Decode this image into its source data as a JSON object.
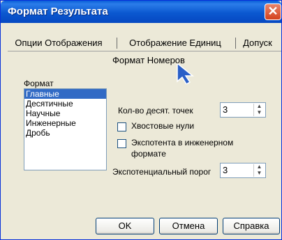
{
  "window": {
    "title": "Формат Результата",
    "close_glyph": "✕"
  },
  "tabs": [
    "Опции Отображения",
    "Отображение Единиц",
    "Допуск"
  ],
  "group_title": "Формат Номеров",
  "format": {
    "label": "Формат",
    "items": [
      "Главные",
      "Десятичные",
      "Научные",
      "Инженерные",
      "Дробь"
    ],
    "selected": "Главные"
  },
  "decimals": {
    "label": "Кол-во десят. точек",
    "value": "3"
  },
  "trailing_zeros": {
    "label": "Хвостовые нули",
    "checked": false
  },
  "engineering_exponent": {
    "label_line1": "Экспотента в инженерном",
    "label_line2": "формате",
    "checked": false
  },
  "exp_threshold": {
    "label": "Экспотенциальный порог",
    "value": "3"
  },
  "buttons": {
    "ok": "OK",
    "cancel": "Отмена",
    "help": "Справка"
  },
  "colors": {
    "titlebar": "#0b58d0",
    "selection": "#316ac5",
    "dialog_bg": "#ece9d8"
  },
  "icons": {
    "spin_up": "▲",
    "spin_down": "▼"
  }
}
